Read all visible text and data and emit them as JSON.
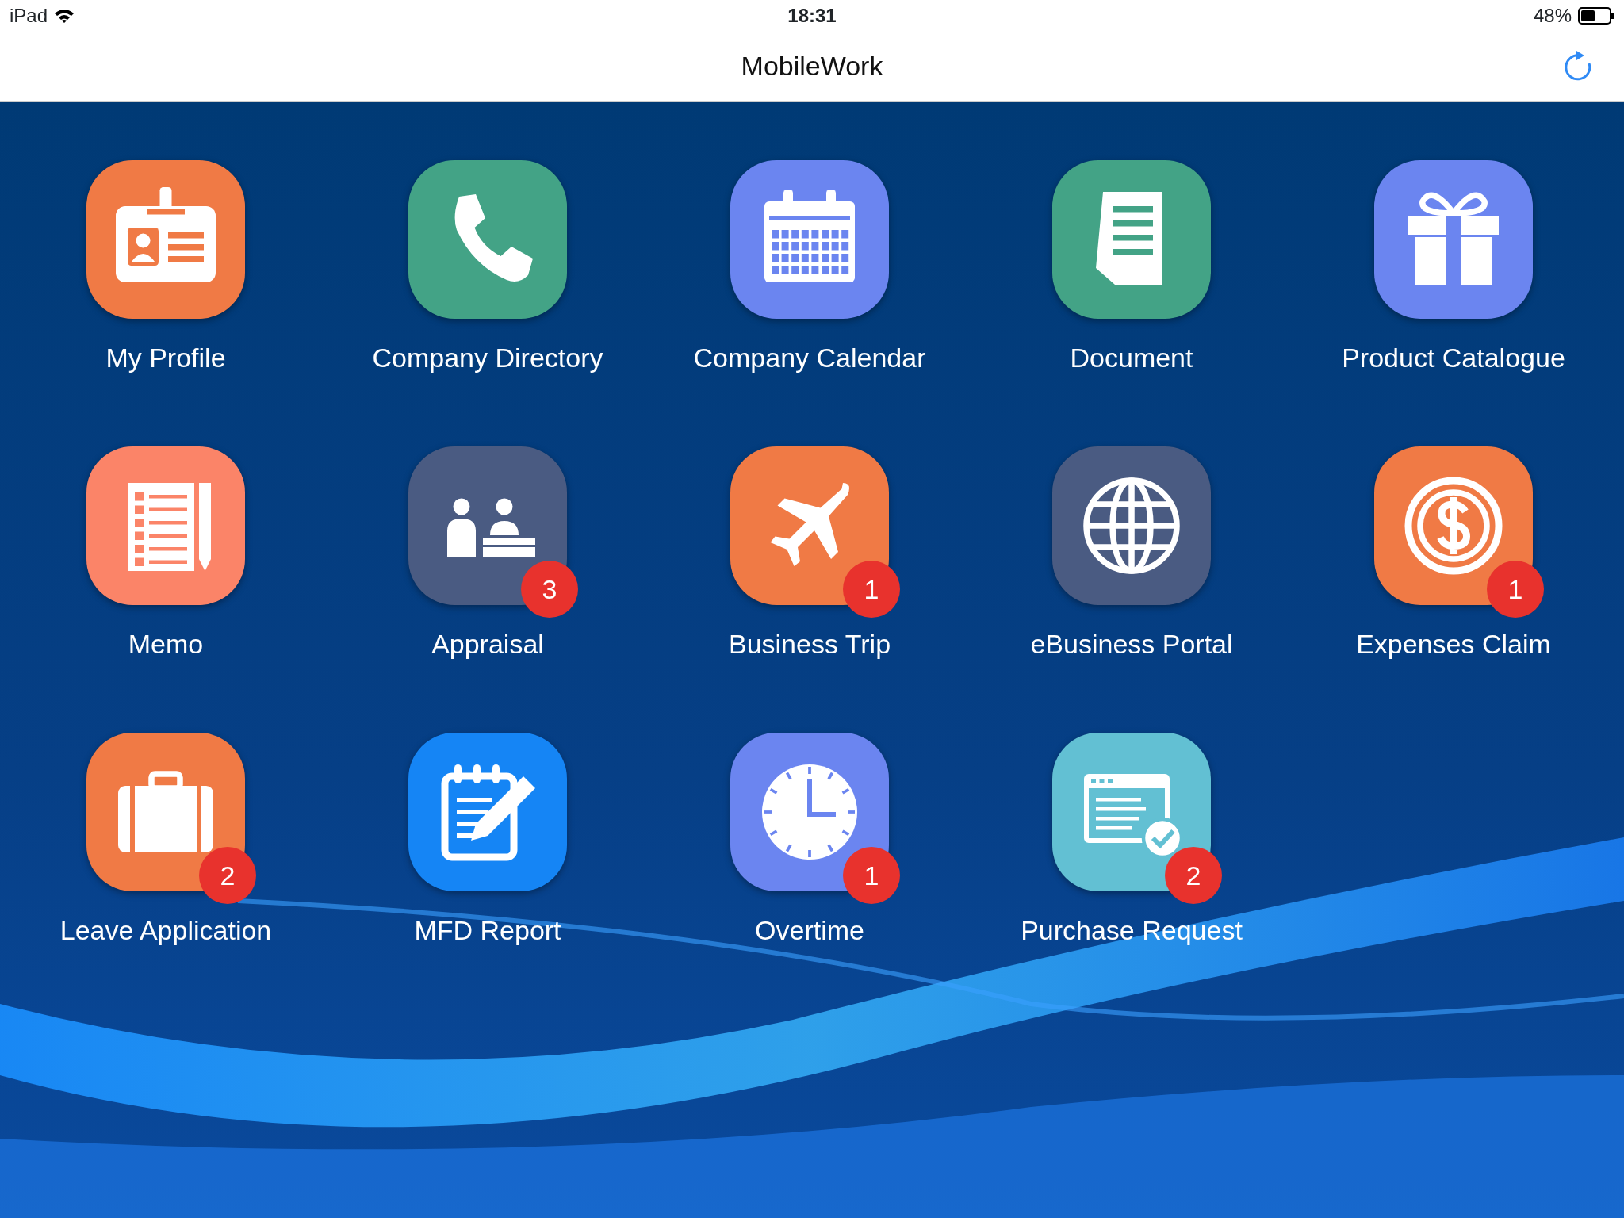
{
  "status_bar": {
    "device": "iPad",
    "time": "18:31",
    "battery": "48%"
  },
  "nav_bar": {
    "title": "MobileWork"
  },
  "apps": [
    {
      "label": "My Profile",
      "kind": "id-card",
      "color": "#f07a45"
    },
    {
      "label": "Company Directory",
      "kind": "phone",
      "color": "#43a386"
    },
    {
      "label": "Company Calendar",
      "kind": "calendar",
      "color": "#6b85f0"
    },
    {
      "label": "Document",
      "kind": "document",
      "color": "#43a386"
    },
    {
      "label": "Product Catalogue",
      "kind": "gift",
      "color": "#6b85f0"
    },
    {
      "label": "Memo",
      "kind": "memo",
      "color": "#fb8468"
    },
    {
      "label": "Appraisal",
      "kind": "people",
      "color": "#4a5b82",
      "badge": "3"
    },
    {
      "label": "Business Trip",
      "kind": "plane",
      "color": "#f07a45",
      "badge": "1"
    },
    {
      "label": "eBusiness Portal",
      "kind": "globe",
      "color": "#4a5b82"
    },
    {
      "label": "Expenses Claim",
      "kind": "dollar",
      "color": "#f07a45",
      "badge": "1"
    },
    {
      "label": "Leave Application",
      "kind": "briefcase",
      "color": "#f07a45",
      "badge": "2"
    },
    {
      "label": "MFD Report",
      "kind": "clipboard",
      "color": "#1585f5"
    },
    {
      "label": "Overtime",
      "kind": "clock",
      "color": "#6b85f0",
      "badge": "1"
    },
    {
      "label": "Purchase Request",
      "kind": "browser",
      "color": "#62c0d3",
      "badge": "2"
    }
  ]
}
